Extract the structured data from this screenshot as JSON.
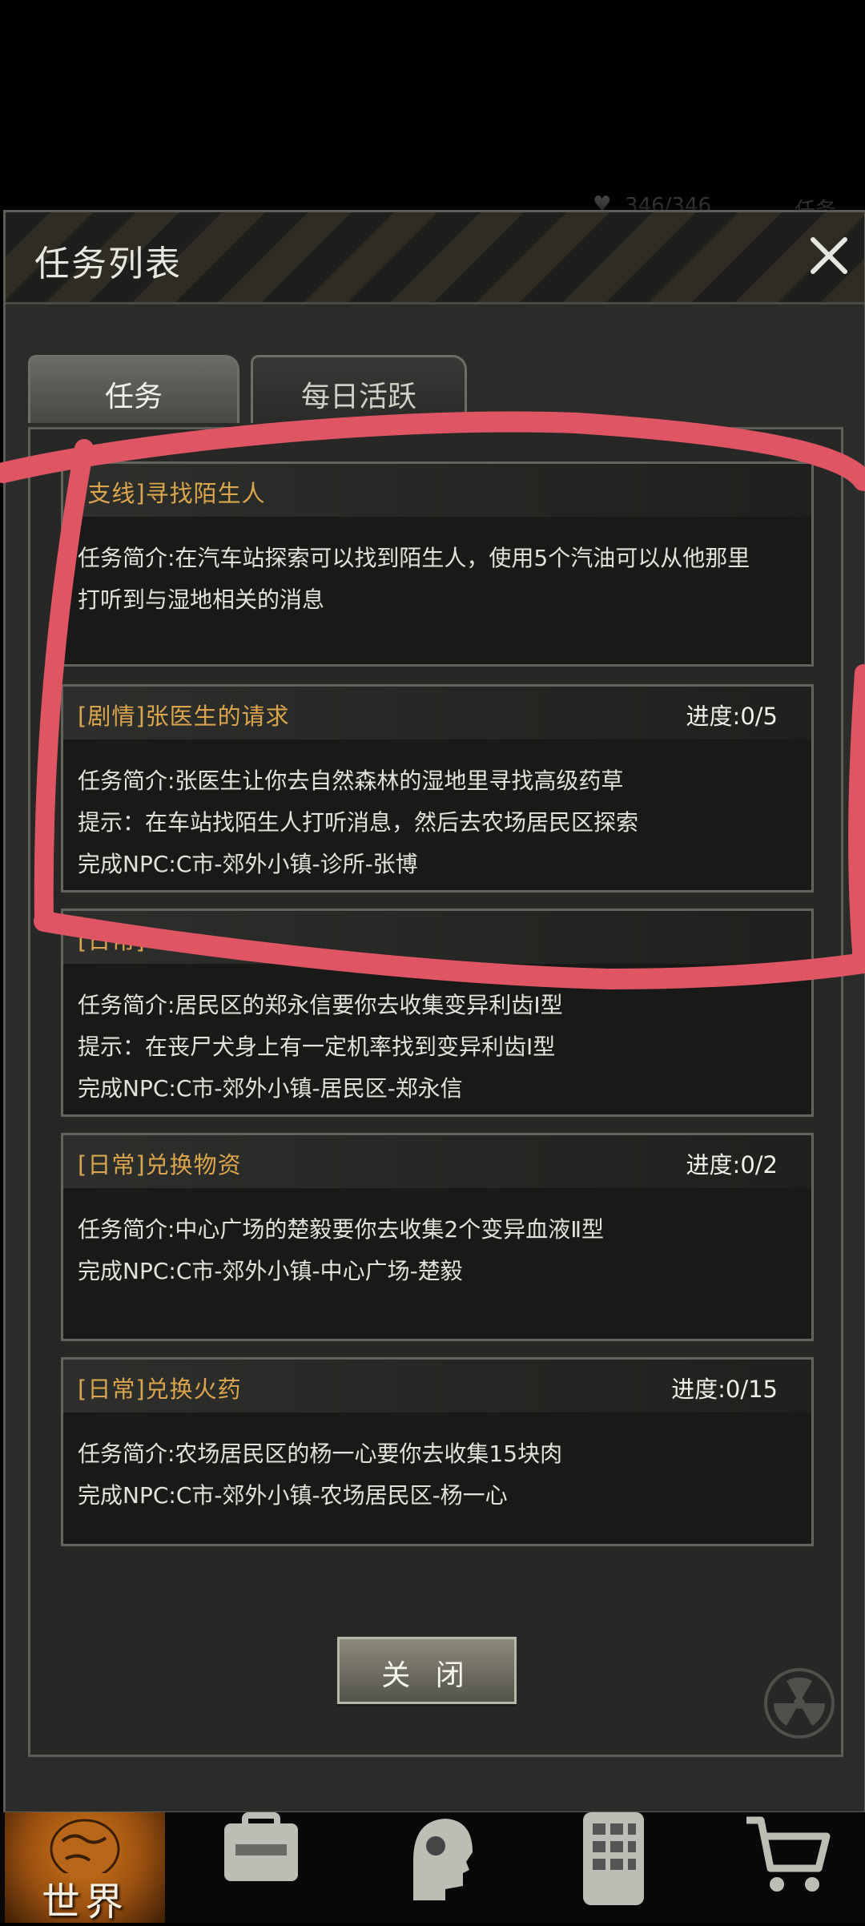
{
  "background_status": {
    "hp": "346/346",
    "task_short": "任务"
  },
  "modal": {
    "title": "任务列表",
    "tabs": [
      {
        "label": "任务",
        "active": true
      },
      {
        "label": "每日活跃",
        "active": false
      }
    ],
    "quests": [
      {
        "title": "[支线]寻找陌生人",
        "progress": "",
        "lines": [
          "任务简介:在汽车站探索可以找到陌生人，使用5个汽油可以从他那里",
          "打听到与湿地相关的消息"
        ]
      },
      {
        "title": "[剧情]张医生的请求",
        "progress": "进度:0/5",
        "lines": [
          "任务简介:张医生让你去自然森林的湿地里寻找高级药草",
          "提示：在车站找陌生人打听消息，然后去农场居民区探索",
          "完成NPC:C市-郊外小镇-诊所-张博"
        ]
      },
      {
        "title": "[日常]",
        "progress": "",
        "lines": [
          "任务简介:居民区的郑永信要你去收集变异利齿Ⅰ型",
          "提示：在丧尸犬身上有一定机率找到变异利齿Ⅰ型",
          "完成NPC:C市-郊外小镇-居民区-郑永信"
        ]
      },
      {
        "title": "[日常]兑换物资",
        "progress": "进度:0/2",
        "lines": [
          "任务简介:中心广场的楚毅要你去收集2个变异血液Ⅱ型",
          "完成NPC:C市-郊外小镇-中心广场-楚毅"
        ]
      },
      {
        "title": "[日常]兑换火药",
        "progress": "进度:0/15",
        "lines": [
          "任务简介:农场居民区的杨一心要你去收集15块肉",
          "完成NPC:C市-郊外小镇-农场居民区-杨一心"
        ]
      }
    ],
    "close_button": "关 闭"
  },
  "bottom_nav": {
    "items": [
      {
        "label": "世界",
        "icon": "globe-icon",
        "active": true
      },
      {
        "label": "",
        "icon": "backpack-icon"
      },
      {
        "label": "",
        "icon": "head-profile-icon"
      },
      {
        "label": "",
        "icon": "phone-icon"
      },
      {
        "label": "",
        "icon": "cart-icon"
      }
    ]
  },
  "colors": {
    "quest_title": "#dba54e",
    "highlight": "#e05563",
    "panel_bg": "#2b2c2a"
  }
}
